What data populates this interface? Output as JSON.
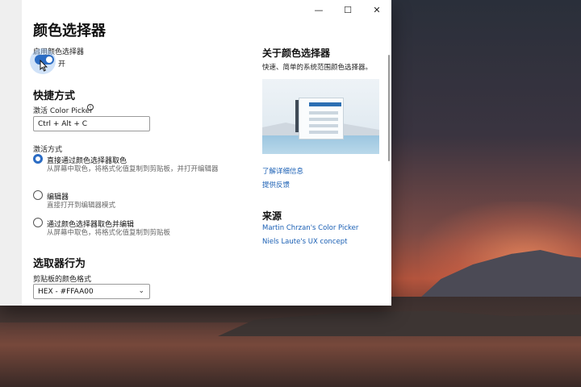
{
  "window": {
    "minimize_glyph": "—",
    "maximize_glyph": "☐",
    "close_glyph": "✕"
  },
  "main": {
    "page_title": "颜色选择器",
    "enable_label": "启用颜色选择器",
    "toggle_state": "开",
    "toggle_on": true,
    "shortcut_section": "快捷方式",
    "activate_label": "激活 Color Picker",
    "info_glyph": "i",
    "shortcut_value": "Ctrl + Alt + C",
    "activation_label": "激活方式",
    "options": [
      {
        "label": "直接通过颜色选择器取色",
        "desc": "从屏幕中取色，将格式化值复制到剪贴板，并打开编辑器",
        "checked": true
      },
      {
        "label": "编辑器",
        "desc": "直接打开到编辑器模式",
        "checked": false
      },
      {
        "label": "通过颜色选择器取色并编辑",
        "desc": "从屏幕中取色，将格式化值复制到剪贴板",
        "checked": false
      }
    ],
    "picker_section": "选取器行为",
    "clipboard_label": "剪贴板的颜色格式",
    "clipboard_value": "HEX - #FFAA00"
  },
  "sidebar": {
    "about_title": "关于颜色选择器",
    "about_desc": "快速、简单的系统范围颜色选择器。",
    "learn_more": "了解详细信息",
    "feedback": "提供反馈",
    "source_title": "来源",
    "source_links": [
      "Martin Chrzan's Color Picker",
      "Niels Laute's UX concept"
    ]
  },
  "colors": {
    "accent": "#2b6cc4",
    "link": "#1a5fb4"
  }
}
